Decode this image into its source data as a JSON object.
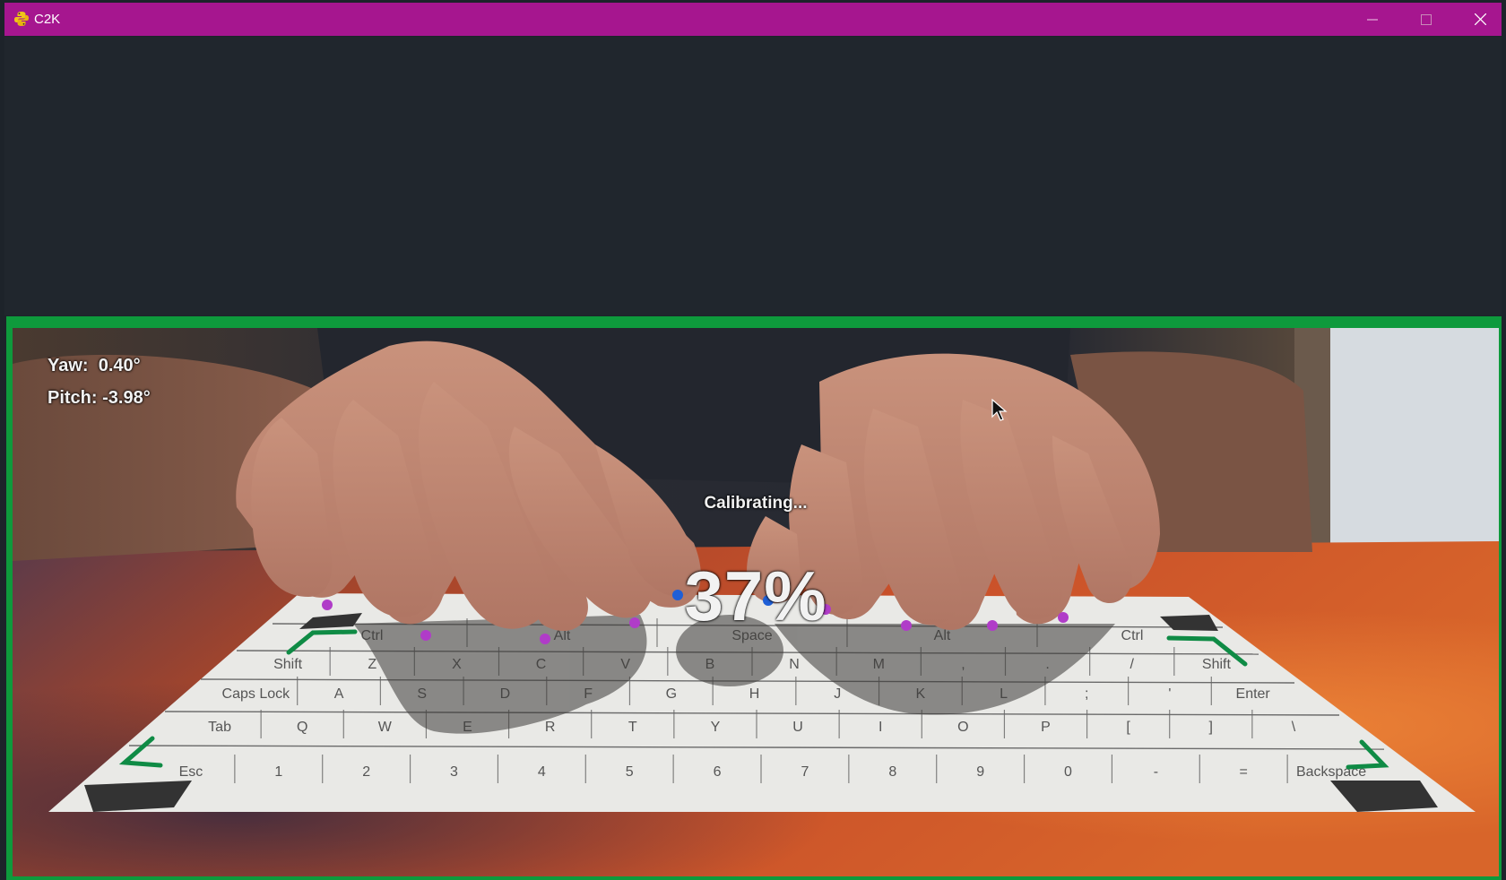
{
  "window": {
    "title": "C2K",
    "app_icon": "python-icon",
    "controls": {
      "minimize": "minimize-icon",
      "maximize": "maximize-icon",
      "close": "close-icon"
    }
  },
  "colors": {
    "titlebar": "#a6168f",
    "frame": "#0e9a3c",
    "fingertip": "#b03cc8",
    "thumb": "#1f5fd6",
    "marker": "#0f8b45"
  },
  "hud": {
    "yaw_label": "Yaw:",
    "yaw_value": "0.40°",
    "pitch_label": "Pitch:",
    "pitch_value": "-3.98°",
    "status": "Calibrating...",
    "progress_text": "37%",
    "progress_value": 37
  },
  "keyboard": {
    "rows": [
      [
        "Esc",
        "1",
        "2",
        "3",
        "4",
        "5",
        "6",
        "7",
        "8",
        "9",
        "0",
        "-",
        "=",
        "Backspace"
      ],
      [
        "Tab",
        "Q",
        "W",
        "E",
        "R",
        "T",
        "Y",
        "U",
        "I",
        "O",
        "P",
        "[",
        "]",
        "\\"
      ],
      [
        "Caps Lock",
        "A",
        "S",
        "D",
        "F",
        "G",
        "H",
        "J",
        "K",
        "L",
        ";",
        "'",
        "Enter"
      ],
      [
        "Shift",
        "Z",
        "X",
        "C",
        "V",
        "B",
        "N",
        "M",
        ",",
        ".",
        "/",
        "Shift"
      ],
      [
        "Ctrl",
        "Alt",
        "Space",
        "Alt",
        "Ctrl"
      ]
    ]
  }
}
